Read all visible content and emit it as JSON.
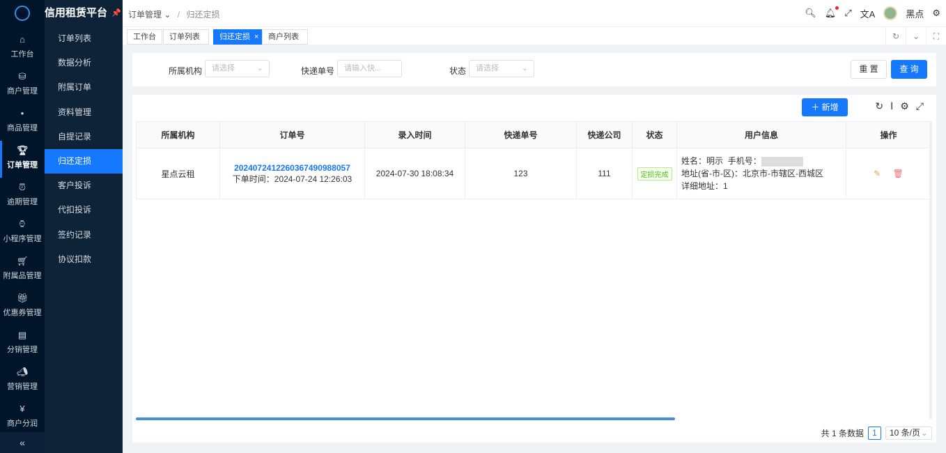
{
  "app": {
    "title": "信用租赁平台"
  },
  "rail": [
    {
      "label": "工作台",
      "icon": "home-icon"
    },
    {
      "label": "商户管理",
      "icon": "shop-icon"
    },
    {
      "label": "商品管理",
      "icon": "apple-icon"
    },
    {
      "label": "订单管理",
      "icon": "trophy-icon",
      "active": true
    },
    {
      "label": "逾期管理",
      "icon": "alarm-icon"
    },
    {
      "label": "小程序管理",
      "icon": "watch-icon"
    },
    {
      "label": "附属品管理",
      "icon": "cart-icon"
    },
    {
      "label": "优惠券管理",
      "icon": "gift-icon"
    },
    {
      "label": "分销管理",
      "icon": "chart-icon"
    },
    {
      "label": "营销管理",
      "icon": "megaphone-icon"
    },
    {
      "label": "商户分润",
      "icon": "yen-icon"
    }
  ],
  "submenu": [
    "订单列表",
    "数据分析",
    "附属订单",
    "资料管理",
    "自提记录",
    "归还定损",
    "客户投诉",
    "代扣投诉",
    "签约记录",
    "协议扣款"
  ],
  "submenu_active": "归还定损",
  "breadcrumb": {
    "parent": "订单管理",
    "current": "归还定损"
  },
  "header": {
    "user": "黑点"
  },
  "tabs": [
    "工作台",
    "订单列表",
    "归还定损",
    "商户列表"
  ],
  "filter": {
    "org_label": "所属机构",
    "org_placeholder": "请选择",
    "tracking_label": "快递单号",
    "tracking_placeholder": "请输入快...",
    "status_label": "状态",
    "status_placeholder": "请选择",
    "reset": "重 置",
    "search": "查 询"
  },
  "toolbar": {
    "add": "新增"
  },
  "table": {
    "columns": [
      "所属机构",
      "订单号",
      "录入时间",
      "快递单号",
      "快递公司",
      "状态",
      "用户信息",
      "操作"
    ],
    "rows": [
      {
        "org": "星点云租",
        "order_no": "2024072412260367490988057",
        "order_time": "下单时间：2024-07-24 12:26:03",
        "entry_time": "2024-07-30 18:08:34",
        "tracking_no": "123",
        "courier": "111",
        "status": "定损完成",
        "user_name": "姓名：明示",
        "user_phone": "手机号：",
        "user_addr": "地址(省-市-区)：北京市-市辖区-西城区",
        "user_detail": "详细地址：1"
      }
    ]
  },
  "pager": {
    "total": "共 1 条数据",
    "page": "1",
    "size": "10 条/页"
  }
}
